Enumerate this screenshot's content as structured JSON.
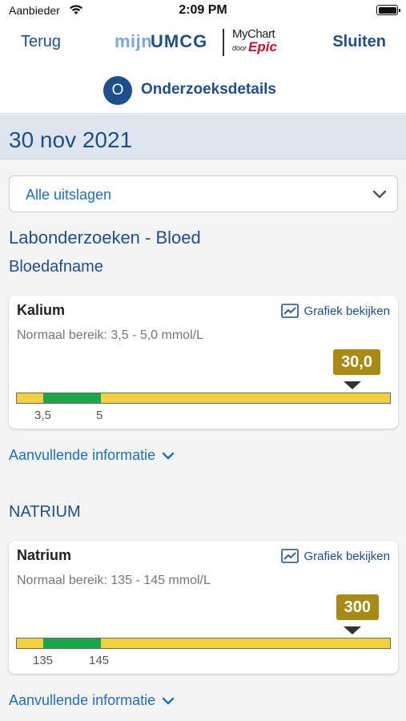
{
  "status": {
    "carrier": "Aanbieder",
    "time": "2:09 PM"
  },
  "nav": {
    "back": "Terug",
    "close": "Sluiten",
    "logo_mijn": "mijn",
    "logo_umcg": "UMCG",
    "logo_mychart": "MyChart",
    "logo_door": "door",
    "logo_epic": "Epic"
  },
  "header": {
    "badge": "O",
    "title": "Onderzoeksdetails"
  },
  "date": "30 nov 2021",
  "filter": {
    "selected": "Alle uitslagen"
  },
  "section": {
    "title": "Labonderzoeken - Bloed",
    "subtitle": "Bloedafname"
  },
  "graph_link": "Grafiek bekijken",
  "extra_info": "Aanvullende informatie",
  "results": [
    {
      "group": "",
      "name": "Kalium",
      "range_text": "Normaal bereik: 3,5 - 5,0 mmol/L",
      "value": "30,0",
      "low_label": "3,5",
      "high_label": "5"
    },
    {
      "group": "NATRIUM",
      "name": "Natrium",
      "range_text": "Normaal bereik: 135 - 145 mmol/L",
      "value": "300",
      "low_label": "135",
      "high_label": "145"
    }
  ],
  "colors": {
    "primary": "#1d4f8d",
    "link": "#1d6fc2",
    "out_of_range": "#f3d13a",
    "normal": "#1aa64a",
    "value_badge": "#a88a14"
  }
}
